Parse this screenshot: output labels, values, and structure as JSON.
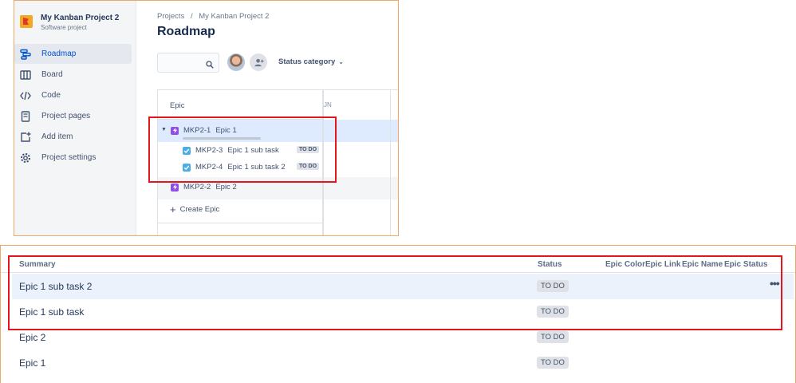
{
  "sidebar": {
    "project_name": "My Kanban Project 2",
    "project_type": "Software project",
    "items": [
      {
        "label": "Roadmap",
        "icon": "roadmap-icon",
        "active": true
      },
      {
        "label": "Board",
        "icon": "board-icon"
      },
      {
        "label": "Code",
        "icon": "code-icon"
      },
      {
        "label": "Project pages",
        "icon": "page-icon"
      },
      {
        "label": "Add item",
        "icon": "add-item-icon"
      },
      {
        "label": "Project settings",
        "icon": "gear-icon"
      }
    ]
  },
  "header": {
    "breadcrumb": [
      "Projects",
      "/",
      "My Kanban Project 2"
    ],
    "title": "Roadmap",
    "search_placeholder": "",
    "status_category": "Status category"
  },
  "roadmap": {
    "epic_header": "Epic",
    "timeline_header": "JN",
    "rows": [
      {
        "key": "MKP2-1",
        "name": "Epic 1",
        "type": "epic"
      },
      {
        "key": "MKP2-3",
        "name": "Epic 1 sub task",
        "type": "task",
        "status": "TO DO"
      },
      {
        "key": "MKP2-4",
        "name": "Epic 1 sub task 2",
        "type": "task",
        "status": "TO DO"
      },
      {
        "key": "MKP2-2",
        "name": "Epic 2",
        "type": "epic"
      }
    ],
    "create_label": "Create Epic"
  },
  "list": {
    "columns": [
      "Summary",
      "Status",
      "Epic Color",
      "Epic Link",
      "Epic Name",
      "Epic Status"
    ],
    "rows": [
      {
        "summary": "Epic 1 sub task 2",
        "status": "TO DO"
      },
      {
        "summary": "Epic 1 sub task",
        "status": "TO DO"
      },
      {
        "summary": "Epic 2",
        "status": "TO DO"
      },
      {
        "summary": "Epic 1",
        "status": "TO DO"
      }
    ],
    "more_label": "•••"
  },
  "colors": {
    "accent": "#0052cc",
    "epic": "#904ee2",
    "task": "#4bade8",
    "highlight_box": "#e4151b",
    "panel_border": "#f0a86a"
  }
}
